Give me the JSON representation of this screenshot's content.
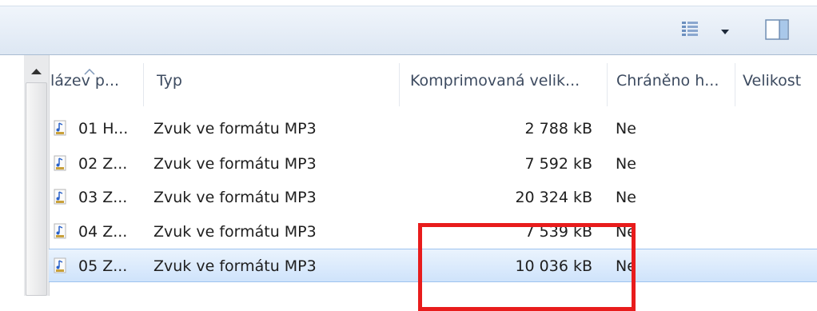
{
  "icons": {
    "view_toggle": "details-view-icon",
    "view_dropdown": "dropdown-triangle-icon",
    "preview_pane": "preview-pane-icon",
    "file": "mp3-file-icon",
    "scroll_up": "scroll-up-arrow-icon",
    "sort": "sort-ascending-icon"
  },
  "columns": [
    {
      "label": "lázev p..."
    },
    {
      "label": "Typ"
    },
    {
      "label": "Komprimovaná velik..."
    },
    {
      "label": "Chráněno h..."
    },
    {
      "label": "Velikost"
    }
  ],
  "rows": [
    {
      "name": "01 H...",
      "type": "Zvuk ve formátu MP3",
      "compressed": "2 788 kB",
      "protected": "Ne",
      "selected": false
    },
    {
      "name": "02 Z...",
      "type": "Zvuk ve formátu MP3",
      "compressed": "7 592 kB",
      "protected": "Ne",
      "selected": false
    },
    {
      "name": "03 Z...",
      "type": "Zvuk ve formátu MP3",
      "compressed": "20 324 kB",
      "protected": "Ne",
      "selected": false
    },
    {
      "name": "04 Z...",
      "type": "Zvuk ve formátu MP3",
      "compressed": "7 539 kB",
      "protected": "Ne",
      "selected": false
    },
    {
      "name": "05 Z...",
      "type": "Zvuk ve formátu MP3",
      "compressed": "10 036 kB",
      "protected": "Ne",
      "selected": true
    }
  ],
  "colors": {
    "selection": "#cfe3fb",
    "annotation": "#e81c1c"
  }
}
